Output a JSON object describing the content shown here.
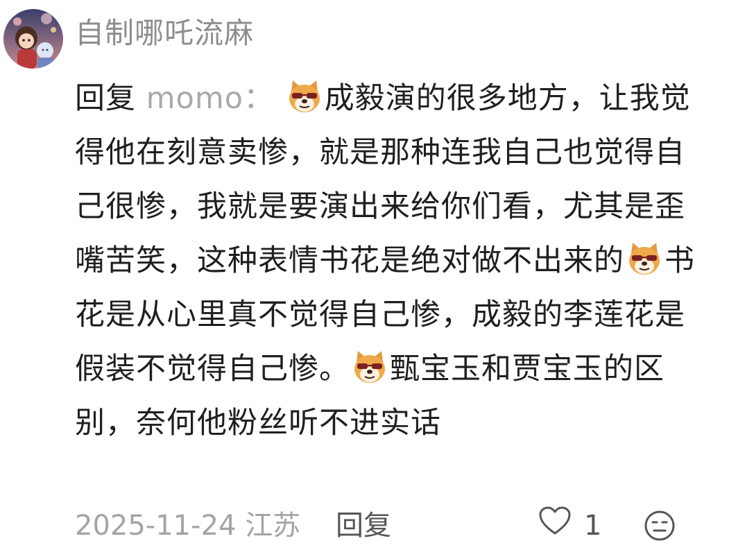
{
  "comment": {
    "username": "自制哪吒流麻",
    "reply_prefix": "回复",
    "reply_target": "momo：",
    "segments": [
      "成毅演的很多地方，让我觉得他在刻意卖惨，就是那种连我自己也觉得自己很惨，我就是要演出来给你们看，尤其是歪嘴苦笑，这种表情书花是绝对做不出来的",
      "书花是从心里真不觉得自己惨，成毅的李莲花是假装不觉得自己惨。",
      "甄宝玉和贾宝玉的区别，奈何他粉丝听不进实话"
    ],
    "emoji_icon": "doge-sunglasses-emoji",
    "date": "2025-11-24",
    "location": "江苏",
    "reply_label": "回复",
    "like_count": "1",
    "like_icon": "heart-outline-icon",
    "react_icon": "neutral-face-icon"
  },
  "colors": {
    "username": "#8d8d8d",
    "text": "#1f1f1f",
    "muted": "#a4a4a4",
    "action": "#555555"
  }
}
